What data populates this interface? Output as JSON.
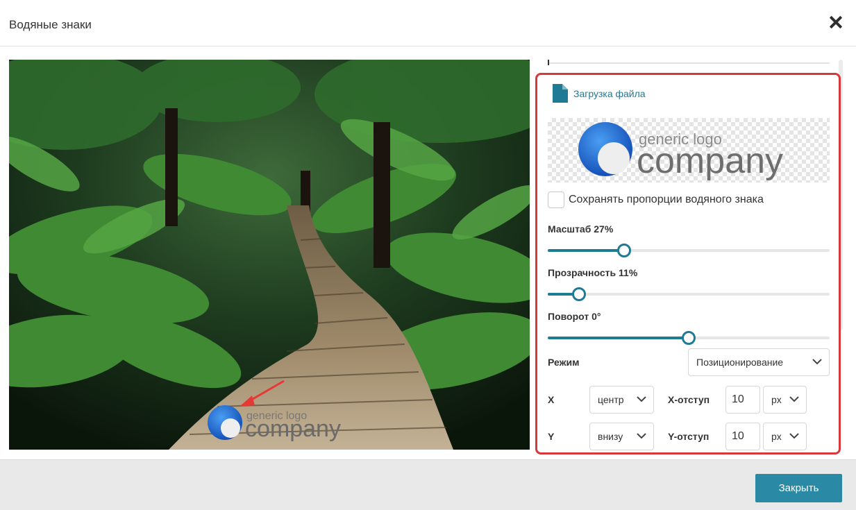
{
  "dialog": {
    "title": "Водяные знаки",
    "close_button_label": "Закрыть"
  },
  "preview": {
    "watermark_top": "generic logo",
    "watermark_bottom": "company"
  },
  "watermark_panel": {
    "upload_label": "Загрузка файла",
    "logo_top": "generic logo",
    "logo_bottom": "company",
    "keep_proportions_label": "Сохранять пропорции водяного знака",
    "keep_proportions_checked": false,
    "scale": {
      "label": "Масштаб 27%",
      "value": 27
    },
    "opacity": {
      "label": "Прозрачность 11%",
      "value": 11
    },
    "rotation": {
      "label": "Поворот 0°",
      "value": 0,
      "min": -180,
      "max": 180
    },
    "mode": {
      "label": "Режим",
      "value": "Позиционирование"
    },
    "x": {
      "label": "X",
      "value": "центр",
      "offset_label": "X-отступ",
      "offset_value": "10",
      "unit": "px"
    },
    "y": {
      "label": "Y",
      "value": "внизу",
      "offset_label": "Y-отступ",
      "offset_value": "10",
      "unit": "px"
    }
  },
  "colors": {
    "accent": "#2a8aa6",
    "highlight_border": "#d9383a",
    "annotation_arrow": "#e53935"
  }
}
